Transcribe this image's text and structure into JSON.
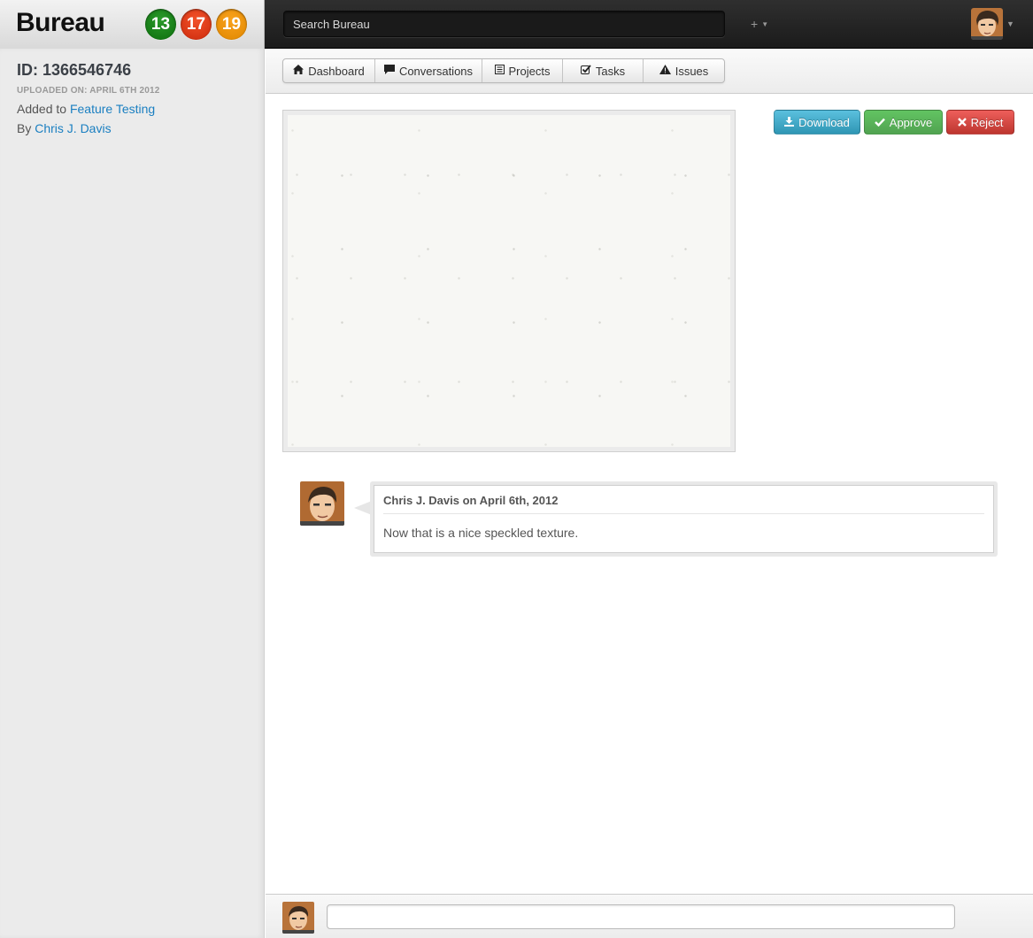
{
  "app": {
    "brand": "Bureau",
    "badges": [
      {
        "count": "13",
        "color": "#128312"
      },
      {
        "count": "17",
        "color": "#e8401c"
      },
      {
        "count": "19",
        "color": "#f29a0e"
      }
    ],
    "search_placeholder": "Search Bureau",
    "plus_label": "+"
  },
  "sidebar": {
    "id_text": "ID: 1366546746",
    "uploaded_text": "UPLOADED ON: APRIL 6TH 2012",
    "added_prefix": "Added to",
    "added_link": "Feature Testing",
    "by_prefix": "By",
    "by_link": "Chris J. Davis"
  },
  "nav": {
    "tabs": [
      {
        "label": "Dashboard",
        "icon": "home-icon"
      },
      {
        "label": "Conversations",
        "icon": "comment-icon"
      },
      {
        "label": "Projects",
        "icon": "list-icon"
      },
      {
        "label": "Tasks",
        "icon": "check-icon"
      },
      {
        "label": "Issues",
        "icon": "warning-icon"
      }
    ]
  },
  "actions": {
    "download": "Download",
    "approve": "Approve",
    "reject": "Reject"
  },
  "comment": {
    "header": "Chris J. Davis on April 6th, 2012",
    "body": "Now that is a nice speckled texture."
  },
  "footer": {
    "input_placeholder": ""
  }
}
